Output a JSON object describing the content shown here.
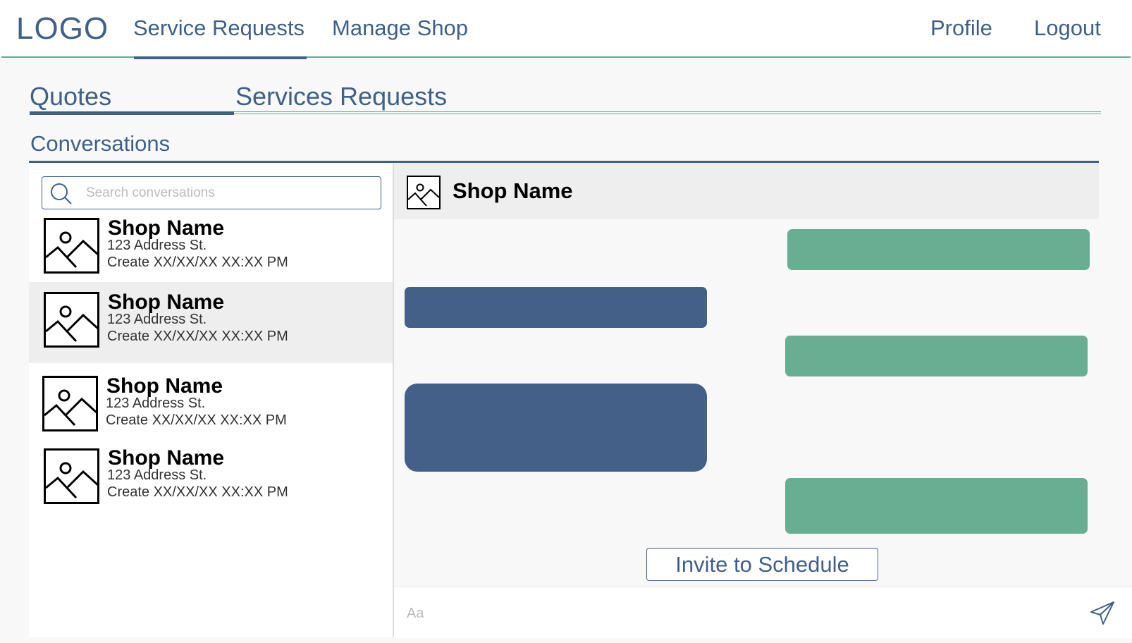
{
  "nav": {
    "logo": "LOGO",
    "service_requests": "Service Requests",
    "manage_shop": "Manage Shop",
    "profile": "Profile",
    "logout": "Logout"
  },
  "tabs": {
    "quotes": "Quotes",
    "services_requests": "Services Requests"
  },
  "section_title": "Conversations",
  "search": {
    "placeholder": "Search conversations"
  },
  "conversations": [
    {
      "name": "Shop Name",
      "address": "123 Address St.",
      "created": "Create XX/XX/XX XX:XX PM"
    },
    {
      "name": "Shop Name",
      "address": "123 Address St.",
      "created": "Create XX/XX/XX XX:XX PM"
    },
    {
      "name": "Shop Name",
      "address": "123 Address St.",
      "created": "Create XX/XX/XX XX:XX PM"
    },
    {
      "name": "Shop Name",
      "address": "123 Address St.",
      "created": "Create XX/XX/XX XX:XX PM"
    }
  ],
  "chat": {
    "shop_name": "Shop Name",
    "invite_label": "Invite to Schedule",
    "message_placeholder": "Aa"
  },
  "colors": {
    "primary": "#40608a",
    "accent": "#69ad93",
    "incoming_bubble": "#445f88",
    "outgoing_bubble": "#69ad93"
  }
}
